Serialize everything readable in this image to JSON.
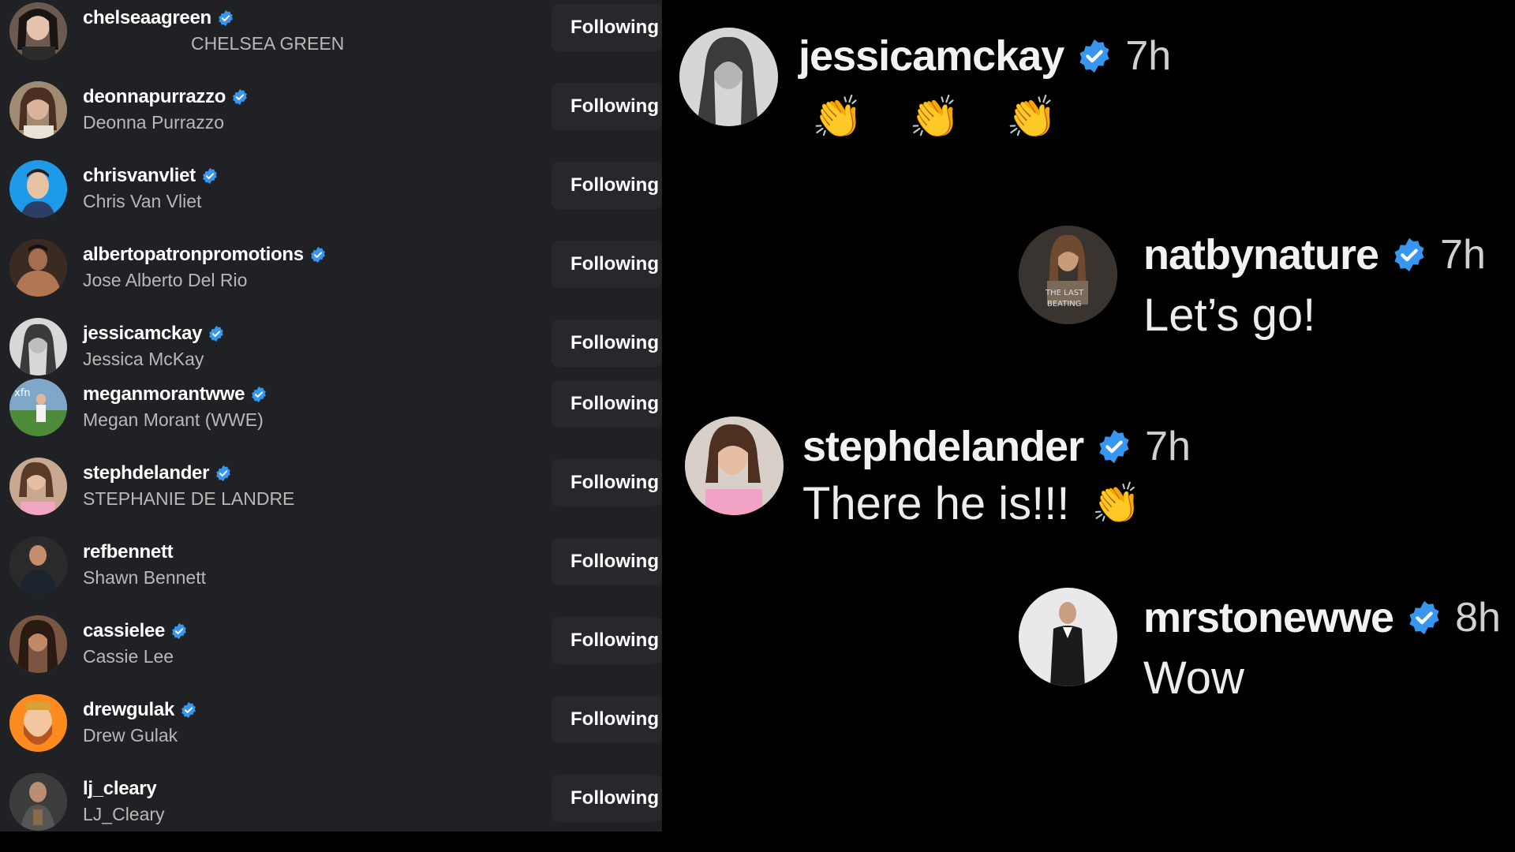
{
  "following_list": [
    {
      "username": "chelseaagreen",
      "display_name": "CHELSEA GREEN",
      "verified": true,
      "button": "Following"
    },
    {
      "username": "deonnapurrazzo",
      "display_name": "Deonna Purrazzo",
      "verified": true,
      "button": "Following"
    },
    {
      "username": "chrisvanvliet",
      "display_name": "Chris Van Vliet",
      "verified": true,
      "button": "Following"
    },
    {
      "username": "albertopatronpromotions",
      "display_name": "Jose Alberto Del Rio",
      "verified": true,
      "button": "Following"
    },
    {
      "username": "jessicamckay",
      "display_name": "Jessica McKay",
      "verified": true,
      "button": "Following"
    },
    {
      "username": "meganmorantwwe",
      "display_name": "Megan Morant (WWE)",
      "verified": true,
      "button": "Following"
    },
    {
      "username": "stephdelander",
      "display_name": "STEPHANIE DE LANDRE",
      "verified": true,
      "button": "Following"
    },
    {
      "username": "refbennett",
      "display_name": "Shawn Bennett",
      "verified": false,
      "button": "Following"
    },
    {
      "username": "cassielee",
      "display_name": "Cassie Lee",
      "verified": true,
      "button": "Following"
    },
    {
      "username": "drewgulak",
      "display_name": "Drew Gulak",
      "verified": true,
      "button": "Following"
    },
    {
      "username": "lj_cleary",
      "display_name": "LJ_Cleary",
      "verified": false,
      "button": "Following"
    }
  ],
  "comments": [
    {
      "username": "jessicamckay",
      "time": "7h",
      "text": "",
      "emoji": "👏 👏 👏"
    },
    {
      "username": "natbynature",
      "time": "7h",
      "text": "Let’s go!",
      "emoji": ""
    },
    {
      "username": "stephdelander",
      "time": "7h",
      "text": "There he is!!!",
      "emoji": "👏"
    },
    {
      "username": "mrstonewwe",
      "time": "8h",
      "text": "Wow",
      "emoji": ""
    }
  ],
  "colors": {
    "list_background": "#202124",
    "comments_background": "#000000",
    "verified_blue": "#3797f0",
    "button_background": "#26282b"
  },
  "icons": {
    "verified": "verified-badge-icon"
  }
}
